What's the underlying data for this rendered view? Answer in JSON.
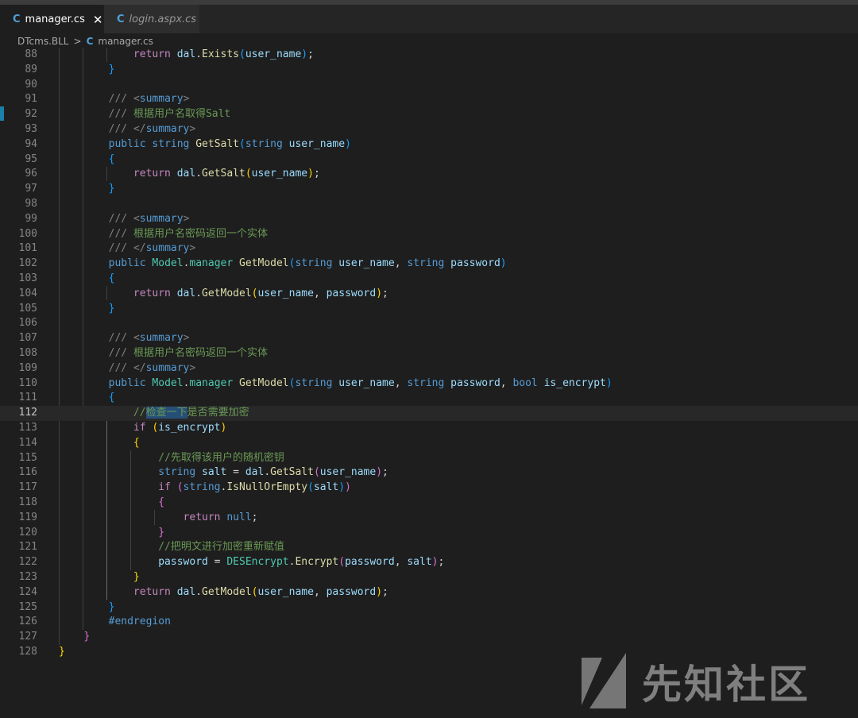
{
  "tabs": [
    {
      "icon": "C",
      "label": "manager.cs",
      "close": "✕"
    },
    {
      "icon": "C",
      "label": "login.aspx.cs"
    }
  ],
  "breadcrumb": {
    "folder": "DTcms.BLL",
    "separator": ">",
    "icon": "C",
    "file": "manager.cs"
  },
  "watermark": {
    "text": "先知社区"
  },
  "colors": {
    "keyword": "#569cd6",
    "type": "#4ec9b0",
    "function": "#dcdcaa",
    "variable": "#9cdcfe",
    "comment": "#6a9955"
  }
}
